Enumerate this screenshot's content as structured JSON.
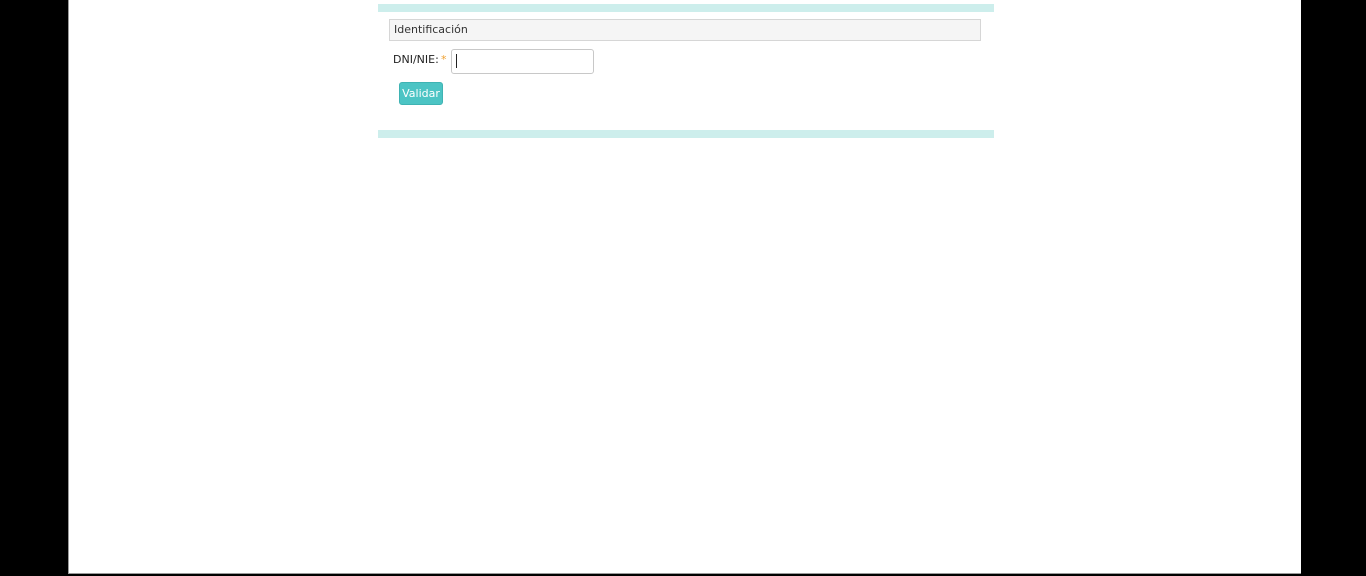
{
  "section": {
    "title": "Identificación"
  },
  "form": {
    "dni_label": "DNI/NIE:",
    "required_mark": "*",
    "dni_value": "",
    "validate_label": "Validar"
  },
  "colors": {
    "band": "#cdeeec",
    "button": "#4cc4c4",
    "required": "#f0a030"
  }
}
